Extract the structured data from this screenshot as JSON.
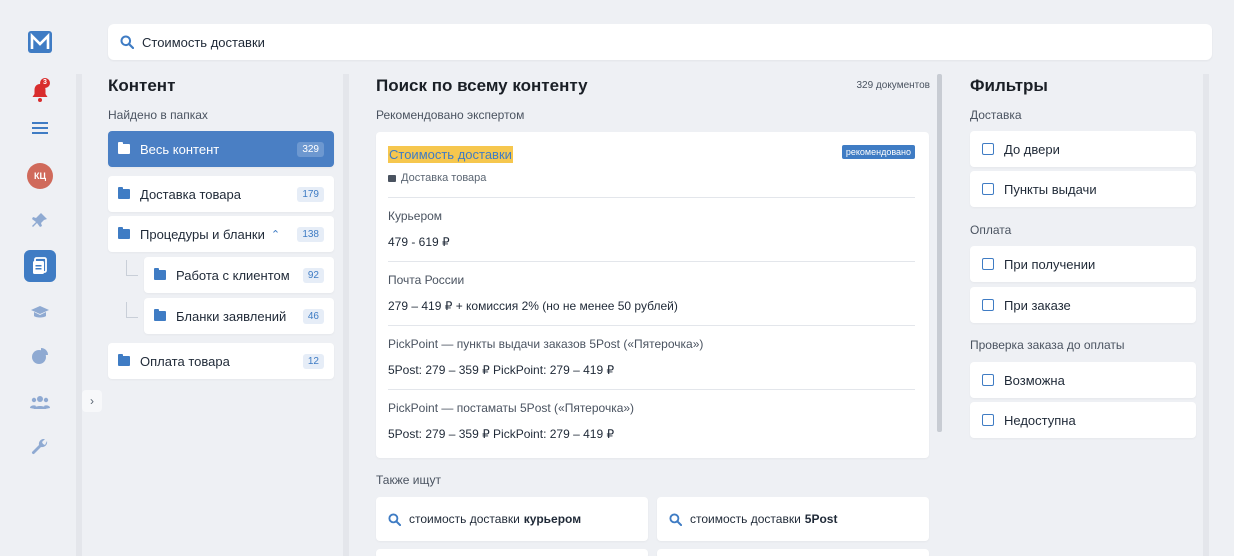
{
  "search": {
    "value": "Стоимость доставки"
  },
  "rail": {
    "notifications_count": "3",
    "avatar_initials": "КЦ"
  },
  "content": {
    "title": "Контент",
    "subtitle": "Найдено в папках",
    "folders": [
      {
        "label": "Весь контент",
        "count": "329"
      },
      {
        "label": "Доставка товара",
        "count": "179"
      },
      {
        "label": "Процедуры и бланки",
        "count": "138"
      },
      {
        "label": "Работа с клиентом",
        "count": "92"
      },
      {
        "label": "Бланки заявлений",
        "count": "46"
      },
      {
        "label": "Оплата товара",
        "count": "12"
      }
    ]
  },
  "main": {
    "title": "Поиск по всему контенту",
    "doc_count": "329 документов",
    "recommended_label": "Рекомендовано экспертом",
    "card": {
      "title": "Стоимость доставки",
      "badge": "рекомендовано",
      "breadcrumb": "Доставка товара",
      "sections": [
        {
          "heading": "Курьером",
          "value": "479 - 619 ₽"
        },
        {
          "heading": "Почта России",
          "value": "279 – 419 ₽ + комиссия 2% (но не менее 50 рублей)"
        },
        {
          "heading": "PickPoint — пункты выдачи заказов 5Post («Пятерочка»)",
          "value": "5Post: 279 – 359 ₽ PickPoint: 279 – 419 ₽"
        },
        {
          "heading": "PickPoint — постаматы 5Post («Пятерочка»)",
          "value": "5Post: 279 – 359 ₽ PickPoint: 279 – 419 ₽"
        }
      ]
    },
    "also_title": "Также ищут",
    "suggestions": [
      {
        "prefix": "стоимость доставки",
        "bold": "курьером"
      },
      {
        "prefix": "стоимость доставки",
        "bold": "5Post"
      }
    ]
  },
  "filters": {
    "title": "Фильтры",
    "groups": [
      {
        "label": "Доставка",
        "items": [
          "До двери",
          "Пункты выдачи"
        ]
      },
      {
        "label": "Оплата",
        "items": [
          "При получении",
          "При заказе"
        ]
      },
      {
        "label": "Проверка заказа до оплаты",
        "items": [
          "Возможна",
          "Недоступна"
        ]
      }
    ]
  },
  "colors": {
    "accent": "#3f7cc4",
    "highlight": "#f6c74e",
    "alert": "#d92d2d"
  }
}
